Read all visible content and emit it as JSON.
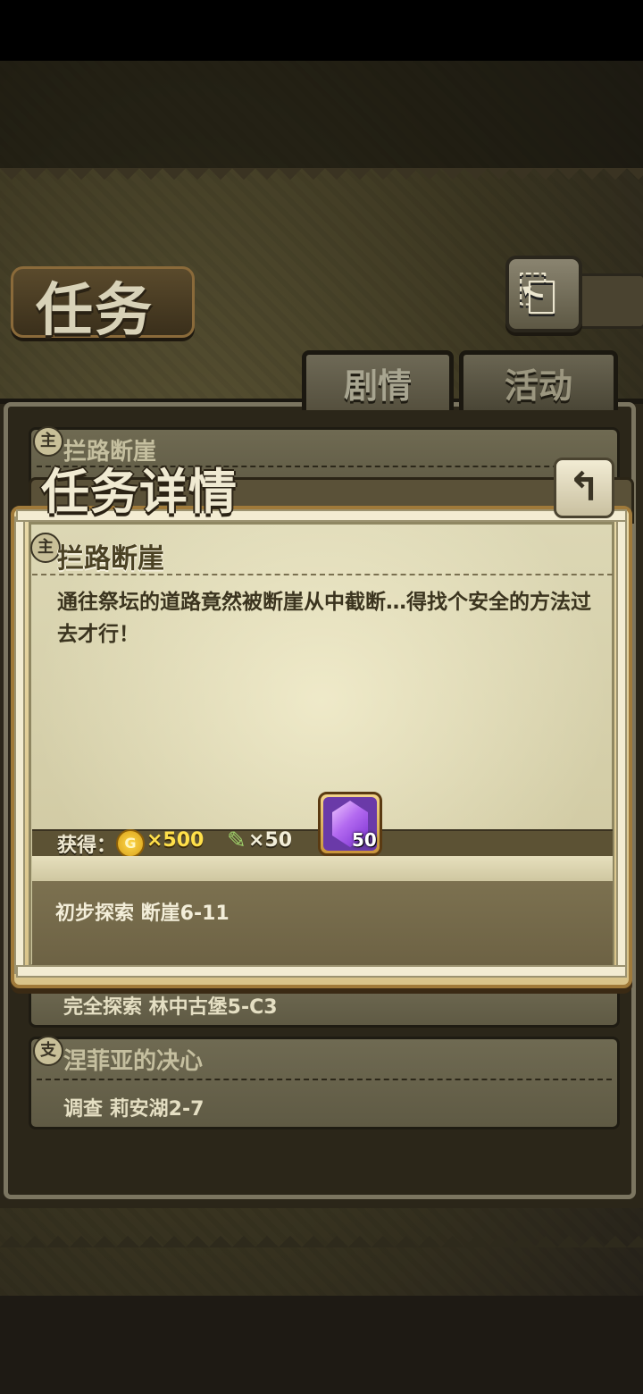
{
  "page": {
    "title": "任务"
  },
  "tabs": [
    {
      "label": "剧情",
      "selected": true
    },
    {
      "label": "活动",
      "selected": false
    }
  ],
  "quest_list": [
    {
      "badge": "主",
      "title": "拦路断崖",
      "objective": ""
    },
    {
      "badge": "",
      "title": "",
      "objective": "完全探索 林中古堡5-C3"
    },
    {
      "badge": "支",
      "title": "涅菲亚的决心",
      "objective": "调查 莉安湖2-7"
    }
  ],
  "dialog": {
    "title": "任务详情",
    "quest_badge": "主",
    "quest_name": "拦路断崖",
    "description": "通往祭坛的道路竟然被断崖从中截断…得找个安全的方法过去才行！",
    "reward_label": "获得：",
    "rewards": [
      {
        "icon": "gold-coin-icon",
        "glyph": "G",
        "amount": "×500"
      },
      {
        "icon": "feather-icon",
        "glyph": "✎",
        "amount": "×50"
      },
      {
        "icon": "purple-gem-icon",
        "amount": "50"
      }
    ],
    "objective": "初步探索 断崖6-11"
  },
  "colors": {
    "gold": "#ffe04a",
    "gem": "#8a3ad6",
    "parchment": "#dcd7b4"
  }
}
